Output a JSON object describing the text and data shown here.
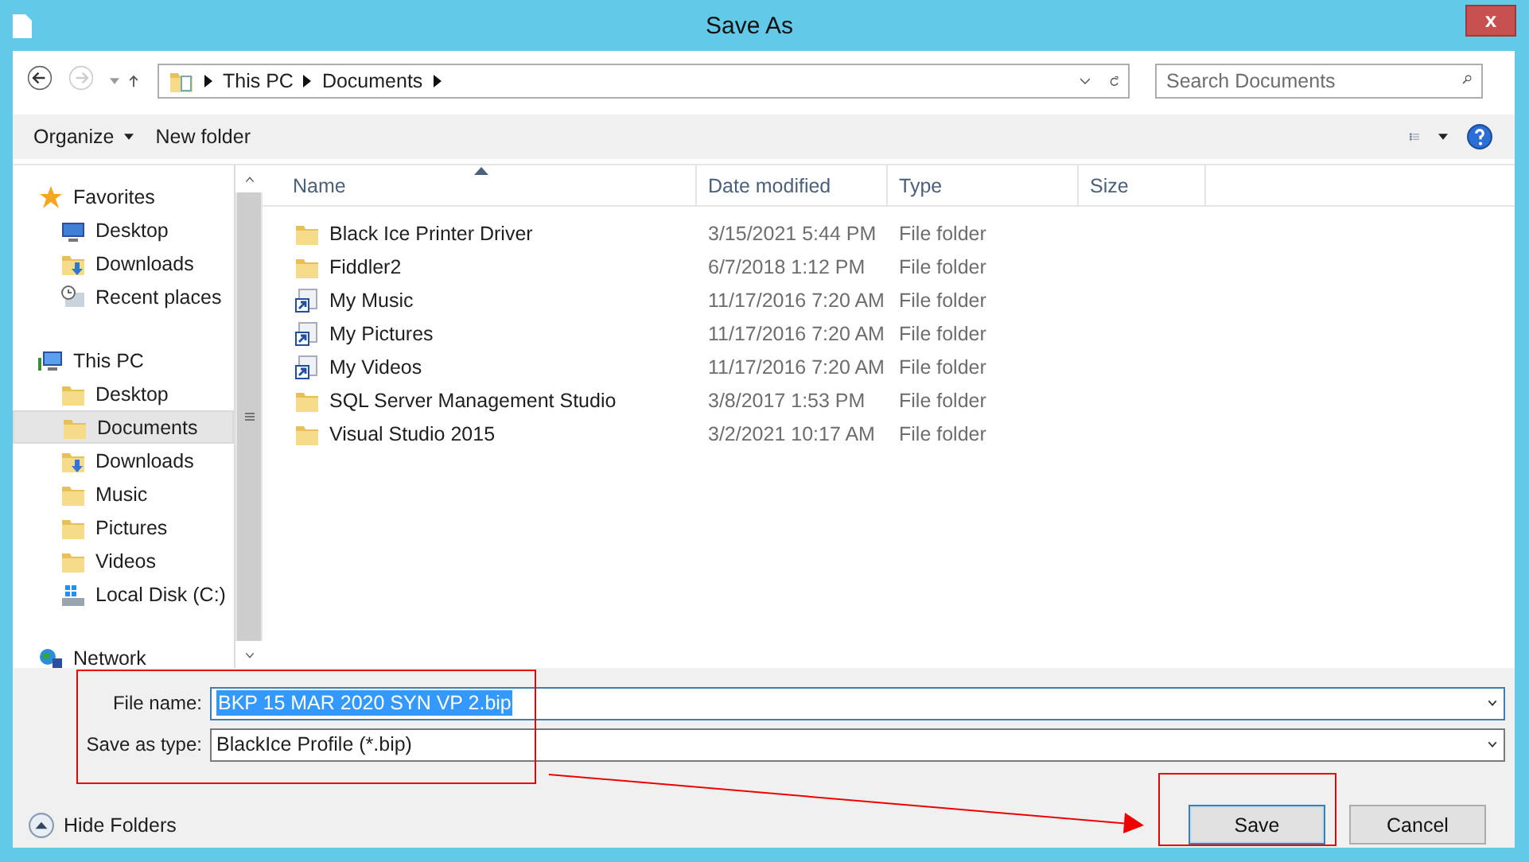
{
  "window": {
    "title": "Save As",
    "close": "x"
  },
  "address": {
    "crumbs": [
      "This PC",
      "Documents"
    ]
  },
  "search": {
    "placeholder": "Search Documents"
  },
  "toolbar": {
    "organize": "Organize",
    "new_folder": "New folder"
  },
  "nav": [
    {
      "label": "Favorites",
      "kind": "favorites",
      "selected": false,
      "children": [
        {
          "label": "Desktop",
          "kind": "desktop",
          "selected": false
        },
        {
          "label": "Downloads",
          "kind": "downloads",
          "selected": false
        },
        {
          "label": "Recent places",
          "kind": "recent",
          "selected": false
        }
      ]
    },
    {
      "label": "This PC",
      "kind": "computer",
      "selected": false,
      "children": [
        {
          "label": "Desktop",
          "kind": "folder",
          "selected": false
        },
        {
          "label": "Documents",
          "kind": "folder",
          "selected": true
        },
        {
          "label": "Downloads",
          "kind": "downloads",
          "selected": false
        },
        {
          "label": "Music",
          "kind": "folder",
          "selected": false
        },
        {
          "label": "Pictures",
          "kind": "folder",
          "selected": false
        },
        {
          "label": "Videos",
          "kind": "folder",
          "selected": false
        },
        {
          "label": "Local Disk (C:)",
          "kind": "disk",
          "selected": false
        }
      ]
    },
    {
      "label": "Network",
      "kind": "network",
      "selected": false
    }
  ],
  "table": {
    "columns": [
      {
        "label": "Name",
        "sorted": true
      },
      {
        "label": "Date modified",
        "sorted": false
      },
      {
        "label": "Type",
        "sorted": false
      },
      {
        "label": "Size",
        "sorted": false
      }
    ],
    "rows": [
      {
        "kind": "folder",
        "name": "Black Ice Printer Driver",
        "date": "3/15/2021 5:44 PM",
        "type": "File folder"
      },
      {
        "kind": "folder",
        "name": "Fiddler2",
        "date": "6/7/2018 1:12 PM",
        "type": "File folder"
      },
      {
        "kind": "shortcut",
        "name": "My Music",
        "date": "11/17/2016 7:20 AM",
        "type": "File folder"
      },
      {
        "kind": "shortcut",
        "name": "My Pictures",
        "date": "11/17/2016 7:20 AM",
        "type": "File folder"
      },
      {
        "kind": "shortcut",
        "name": "My Videos",
        "date": "11/17/2016 7:20 AM",
        "type": "File folder"
      },
      {
        "kind": "folder",
        "name": "SQL Server Management Studio",
        "date": "3/8/2017 1:53 PM",
        "type": "File folder"
      },
      {
        "kind": "folder",
        "name": "Visual Studio 2015",
        "date": "3/2/2021 10:17 AM",
        "type": "File folder"
      }
    ]
  },
  "file_name": {
    "label": "File name:",
    "value": "BKP 15 MAR 2020 SYN VP 2.bip",
    "text_selected": true
  },
  "save_type": {
    "label": "Save as type:",
    "value": "BlackIce Profile (*.bip)"
  },
  "hide_folders": "Hide Folders",
  "buttons": [
    {
      "label": "Save",
      "default": true
    },
    {
      "label": "Cancel",
      "default": false
    }
  ]
}
